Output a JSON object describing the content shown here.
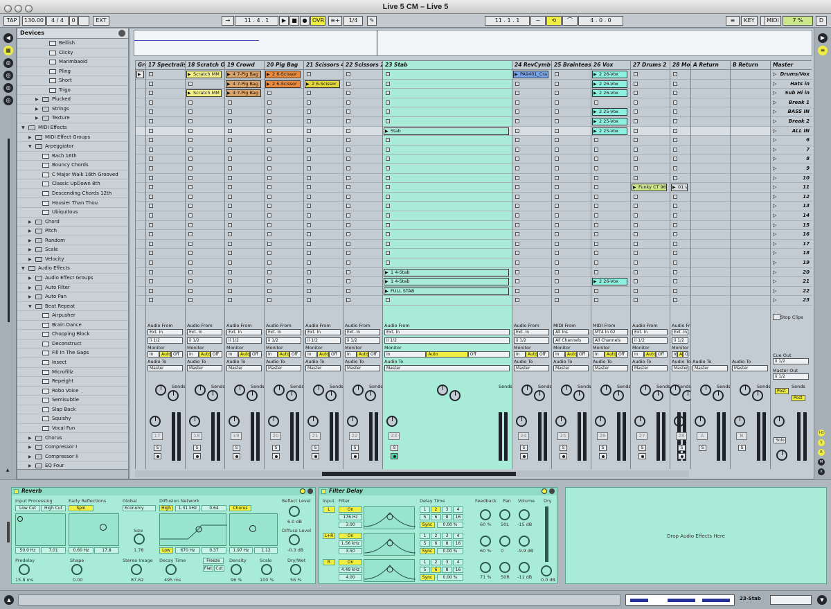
{
  "window": {
    "title": "Live 5 CM – Live 5"
  },
  "transport": {
    "tap": "TAP",
    "tempo": "130.00",
    "sig_num": "4",
    "sig_den": "4",
    "quant_num": "0",
    "ext": "EXT",
    "pos": "11 .   4 .   1",
    "ovr": "OVR",
    "quant": "1/4",
    "loop_start": "11 .   1 .   1",
    "loop_len": "4 .   0 .   0",
    "key": "KEY",
    "midi": "MIDI",
    "cpu": "7 %",
    "dbox": "D"
  },
  "browser": {
    "title": "Devices",
    "items": [
      {
        "l": "Bellish",
        "d": 3,
        "t": "p"
      },
      {
        "l": "Clicky",
        "d": 3,
        "t": "p"
      },
      {
        "l": "Marimbaoid",
        "d": 3,
        "t": "p"
      },
      {
        "l": "Pling",
        "d": 3,
        "t": "p"
      },
      {
        "l": "Short",
        "d": 3,
        "t": "p"
      },
      {
        "l": "Trigo",
        "d": 3,
        "t": "p"
      },
      {
        "l": "Plucked",
        "d": 2,
        "t": "fc"
      },
      {
        "l": "Strings",
        "d": 2,
        "t": "fc"
      },
      {
        "l": "Texture",
        "d": 2,
        "t": "fc"
      },
      {
        "l": "MIDI Effects",
        "d": 0,
        "t": "fo"
      },
      {
        "l": "MIDI Effect Groups",
        "d": 1,
        "t": "fc"
      },
      {
        "l": "Arpeggiator",
        "d": 1,
        "t": "fo"
      },
      {
        "l": "Bach 16th",
        "d": 2,
        "t": "p"
      },
      {
        "l": "Bouncy Chords",
        "d": 2,
        "t": "p"
      },
      {
        "l": "C Major Walk 16th Grooved",
        "d": 2,
        "t": "p"
      },
      {
        "l": "Classic UpDown 8th",
        "d": 2,
        "t": "p"
      },
      {
        "l": "Descending Chords 12th",
        "d": 2,
        "t": "p"
      },
      {
        "l": "Housier Than Thou",
        "d": 2,
        "t": "p"
      },
      {
        "l": "Ubiquitous",
        "d": 2,
        "t": "p"
      },
      {
        "l": "Chord",
        "d": 1,
        "t": "fc"
      },
      {
        "l": "Pitch",
        "d": 1,
        "t": "fc"
      },
      {
        "l": "Random",
        "d": 1,
        "t": "fc"
      },
      {
        "l": "Scale",
        "d": 1,
        "t": "fc"
      },
      {
        "l": "Velocity",
        "d": 1,
        "t": "fc"
      },
      {
        "l": "Audio Effects",
        "d": 0,
        "t": "fo"
      },
      {
        "l": "Audio Effect Groups",
        "d": 1,
        "t": "fc"
      },
      {
        "l": "Auto Filter",
        "d": 1,
        "t": "fc"
      },
      {
        "l": "Auto Pan",
        "d": 1,
        "t": "fc"
      },
      {
        "l": "Beat Repeat",
        "d": 1,
        "t": "fo"
      },
      {
        "l": "Airpusher",
        "d": 2,
        "t": "p"
      },
      {
        "l": "Brain Dance",
        "d": 2,
        "t": "p"
      },
      {
        "l": "Chopping Block",
        "d": 2,
        "t": "p"
      },
      {
        "l": "Deconstruct",
        "d": 2,
        "t": "p"
      },
      {
        "l": "Fill In The Gaps",
        "d": 2,
        "t": "p"
      },
      {
        "l": "Insect",
        "d": 2,
        "t": "p"
      },
      {
        "l": "Microfillz",
        "d": 2,
        "t": "p"
      },
      {
        "l": "Repeight",
        "d": 2,
        "t": "p"
      },
      {
        "l": "Robo Voice",
        "d": 2,
        "t": "p"
      },
      {
        "l": "Semisubtle",
        "d": 2,
        "t": "p"
      },
      {
        "l": "Slap Back",
        "d": 2,
        "t": "p"
      },
      {
        "l": "Squishy",
        "d": 2,
        "t": "p"
      },
      {
        "l": "Vocal Fun",
        "d": 2,
        "t": "p"
      },
      {
        "l": "Chorus",
        "d": 1,
        "t": "fc"
      },
      {
        "l": "Compressor I",
        "d": 1,
        "t": "fc"
      },
      {
        "l": "Compressor II",
        "d": 1,
        "t": "fc"
      },
      {
        "l": "EQ Four",
        "d": 1,
        "t": "fc"
      }
    ]
  },
  "tracks": [
    {
      "name": "Grou",
      "num": "",
      "sel": false
    },
    {
      "name": "17 Spectralis",
      "num": "17",
      "sel": false
    },
    {
      "name": "18 Scratch Oi",
      "num": "18",
      "sel": false
    },
    {
      "name": "19 Crowd",
      "num": "19",
      "sel": false
    },
    {
      "name": "20 Pig Bag",
      "num": "20",
      "sel": false
    },
    {
      "name": "21 Scissors 4",
      "num": "21",
      "sel": false
    },
    {
      "name": "22 Scissors 2",
      "num": "22",
      "sel": false
    },
    {
      "name": "23 Stab",
      "num": "23",
      "sel": true
    },
    {
      "name": "24 RevCymb",
      "num": "24",
      "sel": false
    },
    {
      "name": "25 Brainteasc",
      "num": "25",
      "sel": false
    },
    {
      "name": "26 Vox",
      "num": "26",
      "sel": false
    },
    {
      "name": "27 Drums 2",
      "num": "27",
      "sel": false
    },
    {
      "name": "28 Mo",
      "num": "28",
      "sel": false
    },
    {
      "name": "A Return",
      "num": "A",
      "sel": false
    },
    {
      "name": "B Return",
      "num": "B",
      "sel": false
    }
  ],
  "clips": [
    {
      "c": 0,
      "r": 0,
      "t": "ectr",
      "col": "#e8e8e8"
    },
    {
      "c": 2,
      "r": 0,
      "t": "Scratch MM",
      "col": "#f3f08a"
    },
    {
      "c": 2,
      "r": 2,
      "t": "Scratch MM",
      "col": "#f3f08a"
    },
    {
      "c": 3,
      "r": 0,
      "t": "4 7-Pig Bag",
      "col": "#d9a36a"
    },
    {
      "c": 3,
      "r": 1,
      "t": "4 7-Pig Bag",
      "col": "#d9a36a"
    },
    {
      "c": 3,
      "r": 2,
      "t": "4 7-Pig Bag",
      "col": "#d9a36a"
    },
    {
      "c": 4,
      "r": 0,
      "t": "2 6-Scissor",
      "col": "#e98a3c"
    },
    {
      "c": 4,
      "r": 1,
      "t": "2 6-Scissor",
      "col": "#e98a3c"
    },
    {
      "c": 5,
      "r": 1,
      "t": "2 6-Scissor",
      "col": "#e2d83e"
    },
    {
      "c": 7,
      "r": 6,
      "t": "Stab",
      "col": "#a8ecd8"
    },
    {
      "c": 7,
      "r": 21,
      "t": "1 4-Stab",
      "col": "#a8ecd8"
    },
    {
      "c": 7,
      "r": 22,
      "t": "1 4-Stab",
      "col": "#a8ecd8"
    },
    {
      "c": 7,
      "r": 23,
      "t": "FULL STAB",
      "col": "#a8ecd8"
    },
    {
      "c": 8,
      "r": 0,
      "t": "PA9401_Cra",
      "col": "#7aa4e6"
    },
    {
      "c": 10,
      "r": 0,
      "t": "2 26-Vox",
      "col": "#8ef0e0"
    },
    {
      "c": 10,
      "r": 1,
      "t": "2 26-Vox",
      "col": "#8ef0e0"
    },
    {
      "c": 10,
      "r": 2,
      "t": "2 26-Vox",
      "col": "#8ef0e0"
    },
    {
      "c": 10,
      "r": 4,
      "t": "2 25-Vox",
      "col": "#8ef0e0"
    },
    {
      "c": 10,
      "r": 5,
      "t": "2 25-Vox",
      "col": "#8ef0e0"
    },
    {
      "c": 10,
      "r": 6,
      "t": "2 25-Vox",
      "col": "#8ef0e0"
    },
    {
      "c": 10,
      "r": 22,
      "t": "2 26-Vox",
      "col": "#8ef0e0"
    },
    {
      "c": 11,
      "r": 12,
      "t": "Funky CT 96",
      "col": "#cbe78a"
    },
    {
      "c": 12,
      "r": 12,
      "t": "01 v",
      "col": "#d8dde0"
    }
  ],
  "scenes": [
    "Drums/Vox",
    "Hats in",
    "Sub Hi in",
    "Break 1",
    "BASS IN",
    "Break 2",
    "ALL IN",
    "6",
    "7",
    "8",
    "9",
    "10",
    "11",
    "12",
    "13",
    "14",
    "15",
    "16",
    "17",
    "18",
    "19",
    "20",
    "21",
    "22",
    "23"
  ],
  "master": {
    "title": "Master",
    "stop": "Stop Clips",
    "cue_out": "Cue Out",
    "cue_val": "ii 1/2",
    "master_out": "Master Out",
    "master_val": "ii 1/2",
    "post1": "Post",
    "post2": "Post",
    "solo": "Solo"
  },
  "mixer": {
    "audio_from": "Audio From",
    "midi_from": "MIDI From",
    "ext_in": "Ext. In",
    "all_ins": "All Ins",
    "mt4": "MT4 In 02",
    "ch": "ii 1/2",
    "all_ch": "All Channels",
    "monitor": "Monitor",
    "in": "In",
    "auto": "Auto",
    "off": "Off",
    "audio_to": "Audio To",
    "dest": "Master",
    "sends": "Sends"
  },
  "devices": {
    "reverb": {
      "title": "Reverb",
      "input": "Input Processing",
      "lowcut": "Low Cut",
      "highcut": "High Cut",
      "v1": "50.0 Hz",
      "v2": "7.01",
      "early": "Early Reflections",
      "spin": "Spin",
      "v3": "0.60 Hz",
      "v4": "17.8",
      "global": "Global",
      "eco": "Economy",
      "size": "Size",
      "sizev": "1.78",
      "diff": "Diffusion Network",
      "high": "High",
      "hf": "1.31 kHz",
      "hv": "0.64",
      "chorus": "Chorus",
      "low": "Low",
      "lf": "670 Hz",
      "lv": "0.37",
      "cf": "1.97 Hz",
      "cv": "1.12",
      "refl": "Reflect Level",
      "reflv": "6.0 dB",
      "diffl": "Diffuse Level",
      "difflv": "-0.3 dB",
      "predelay": "Predelay",
      "pdv": "15.8 ms",
      "shape": "Shape",
      "shapev": "0.00",
      "stereo": "Stereo Image",
      "stv": "87.62",
      "decay": "Decay Time",
      "decv": "495 ms",
      "freeze": "Freeze",
      "flat": "Flat",
      "cut": "Cut",
      "density": "Density",
      "denv": "96 %",
      "scale": "Scale",
      "scv": "100 %",
      "drywet": "Dry/Wet",
      "dwv": "56 %"
    },
    "fdelay": {
      "title": "Filter Delay",
      "input": "Input",
      "filter": "Filter",
      "dtime": "Delay Time",
      "fb": "Feedback",
      "pan": "Pan",
      "vol": "Volume",
      "dry": "Dry",
      "l": "L",
      "lr": "L+R",
      "r": "R",
      "on": "On",
      "f1": "176 Hz",
      "q1": "3.00",
      "f2": "1.56 kHz",
      "q2": "3.50",
      "f3": "4.49 kHz",
      "q3": "4.00",
      "sync": "Sync",
      "pct": "0.00 %",
      "fb1": "60 %",
      "pan1": "50L",
      "vol1": "-15 dB",
      "fb2": "60 %",
      "pan2": "0",
      "vol2": "-9.9 dB",
      "fb3": "71 %",
      "pan3": "50R",
      "vol3": "-11 dB",
      "dryv": "0.0 dB",
      "grid": [
        "1",
        "2",
        "3",
        "4",
        "5",
        "6",
        "8",
        "16"
      ]
    },
    "drop": "Drop Audio Effects Here"
  },
  "status": {
    "track": "23-Stab"
  }
}
